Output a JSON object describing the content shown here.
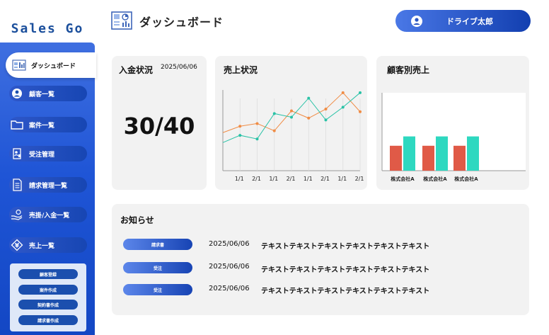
{
  "app": {
    "brand": "Sales Go",
    "page_title": "ダッシュボード",
    "user_name": "ドライブ太郎"
  },
  "colors": {
    "primary": "#1f55d6",
    "series_orange": "#f08c45",
    "series_teal": "#29c2a6",
    "bar_red": "#e05a47",
    "bar_teal": "#2ed8c0"
  },
  "sidebar": {
    "items": [
      {
        "label": "ダッシュボード",
        "icon": "dashboard-icon"
      },
      {
        "label": "顧客一覧",
        "icon": "user-circle-icon"
      },
      {
        "label": "案件一覧",
        "icon": "folder-icon"
      },
      {
        "label": "受注管理",
        "icon": "order-document-icon"
      },
      {
        "label": "請求管理一覧",
        "icon": "invoice-icon"
      },
      {
        "label": "売掛/入金一覧",
        "icon": "hand-coin-icon"
      },
      {
        "label": "売上一覧",
        "icon": "yen-icon"
      }
    ],
    "sub_buttons": [
      "顧客登録",
      "案件作成",
      "契約書作成",
      "請求書作成"
    ]
  },
  "payment": {
    "title": "入金状況",
    "date": "2025/06/06",
    "value": "30/40"
  },
  "sales": {
    "title": "売上状況"
  },
  "customer_sales": {
    "title": "顧客別売上"
  },
  "news": {
    "title": "お知らせ",
    "items": [
      {
        "badge": "請求書",
        "date": "2025/06/06",
        "text": "テキストテキストテキストテキストテキストテキスト"
      },
      {
        "badge": "受注",
        "date": "2025/06/06",
        "text": "テキストテキストテキストテキストテキストテキスト"
      },
      {
        "badge": "受注",
        "date": "2025/06/06",
        "text": "テキストテキストテキストテキストテキストテキスト"
      }
    ]
  },
  "chart_data": [
    {
      "type": "line",
      "title": "売上状況",
      "categories": [
        "1/1",
        "2/1",
        "1/1",
        "2/1",
        "1/1",
        "2/1",
        "1/1",
        "2/1"
      ],
      "ylim": [
        0,
        10
      ],
      "series": [
        {
          "color": "#f08c45",
          "values": [
            4.2,
            4.9,
            5.2,
            4.4,
            6.6,
            5.8,
            6.8,
            8.6,
            6.5
          ]
        },
        {
          "color": "#29c2a6",
          "values": [
            3.1,
            3.9,
            3.5,
            6.3,
            5.9,
            8.0,
            5.6,
            7.0,
            8.6
          ]
        }
      ]
    },
    {
      "type": "bar",
      "title": "顧客別売上",
      "categories": [
        "株式会社A",
        "株式会社A",
        "株式会社A"
      ],
      "ylim": [
        0,
        10
      ],
      "series": [
        {
          "color": "#e05a47",
          "values": [
            3.2,
            3.2,
            3.2
          ]
        },
        {
          "color": "#2ed8c0",
          "values": [
            4.4,
            4.4,
            4.4
          ]
        }
      ]
    }
  ]
}
